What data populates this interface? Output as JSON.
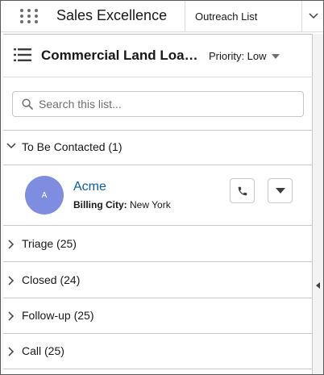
{
  "header": {
    "app_name": "Sales Excellence",
    "nav_tab": "Outreach List"
  },
  "list": {
    "title": "Commercial Land Loan ...",
    "priority_label": "Priority: Low"
  },
  "search": {
    "placeholder": "Search this list...",
    "value": ""
  },
  "sections": {
    "to_be_contacted": "To Be Contacted (1)",
    "triage": "Triage (25)",
    "closed": "Closed (24)",
    "follow_up": "Follow-up (25)",
    "call": "Call (25)"
  },
  "record": {
    "avatar_initial": "A",
    "avatar_color": "#7f8de1",
    "name": "Acme",
    "field_label": "Billing City:",
    "field_value": "New York"
  },
  "colors": {
    "link": "#0b5cab",
    "border": "#c9c7c5",
    "icon": "#706e6b"
  },
  "icons": {
    "app_launcher": "waffle-icon",
    "list": "list-icon",
    "search": "search-icon",
    "phone": "phone-icon",
    "expand": "chevron-right-icon",
    "collapse": "chevron-down-icon"
  }
}
